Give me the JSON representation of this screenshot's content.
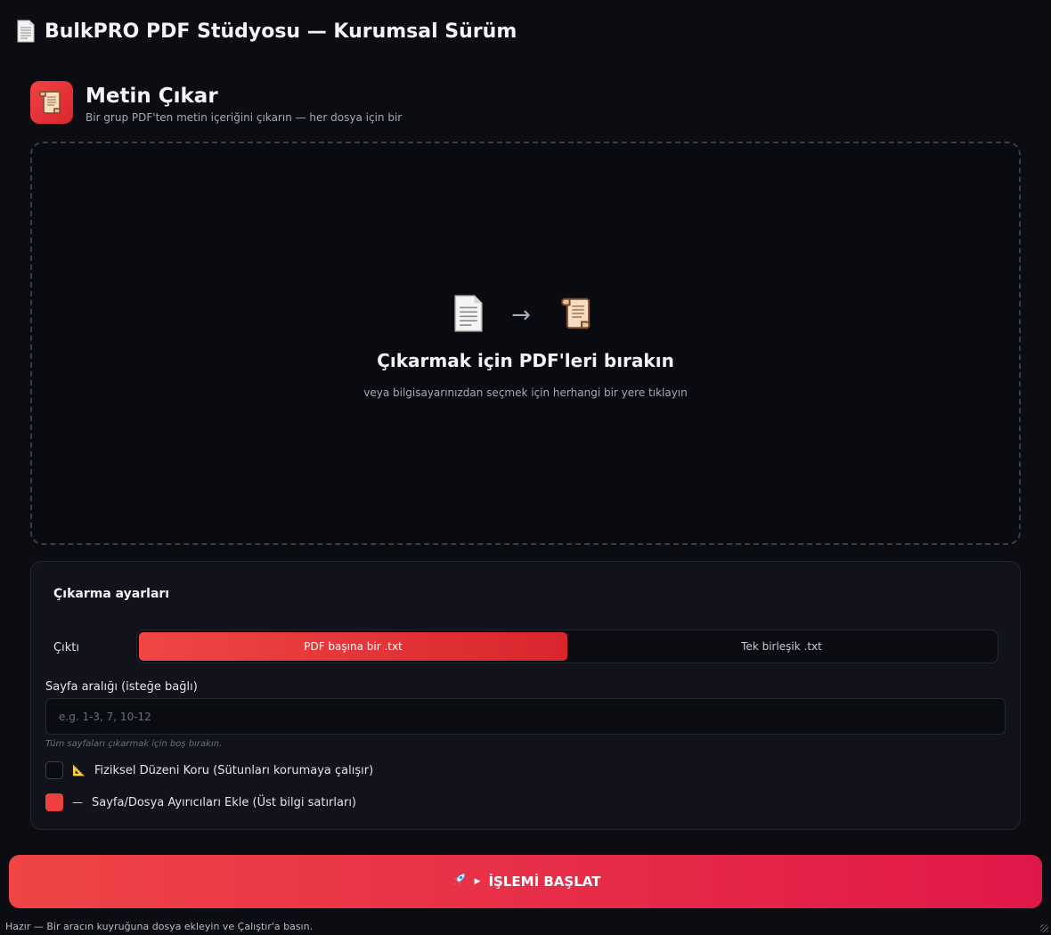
{
  "app": {
    "title": "BulkPRO PDF Stüdyosu — Kurumsal Sürüm",
    "icon": "document-icon"
  },
  "tool": {
    "title": "Metin Çıkar",
    "subtitle": "Bir grup PDF'ten metin içeriğini çıkarın — her dosya için bir",
    "icon": "scroll-icon",
    "accent": "#ef4444"
  },
  "dropzone": {
    "from_icon": "pdf-document-icon",
    "arrow": "→",
    "to_icon": "scroll-icon",
    "title": "Çıkarmak için PDF'leri bırakın",
    "subtitle": "veya bilgisayarınızdan seçmek için herhangi bir yere tıklayın"
  },
  "settings": {
    "title": "Çıkarma ayarları",
    "output_label": "Çıktı",
    "output_options": [
      {
        "label": "PDF başına bir .txt",
        "selected": true
      },
      {
        "label": "Tek birleşik .txt",
        "selected": false
      }
    ],
    "page_range_label": "Sayfa aralığı (isteğe bağlı)",
    "page_range_value": "",
    "page_range_placeholder": "e.g. 1-3, 7, 10-12",
    "page_range_hint": "Tüm sayfaları çıkarmak için boş bırakın.",
    "options": [
      {
        "icon": "📐",
        "label": "Fiziksel Düzeni Koru (Sütunları korumaya çalışır)",
        "checked": false
      },
      {
        "icon": "—",
        "label": "Sayfa/Dosya Ayırıcıları Ekle (Üst bilgi satırları)",
        "checked": true
      }
    ]
  },
  "run_button": {
    "icon": "rocket-icon",
    "play": "▶",
    "label": "İŞLEMİ BAŞLAT"
  },
  "status": {
    "text": "Hazır — Bir aracın kuyruğuna dosya ekleyin ve Çalıştır'a basın."
  },
  "colors": {
    "background": "#0c0d12",
    "accent_start": "#ef4545",
    "accent_end": "#e0184a"
  }
}
